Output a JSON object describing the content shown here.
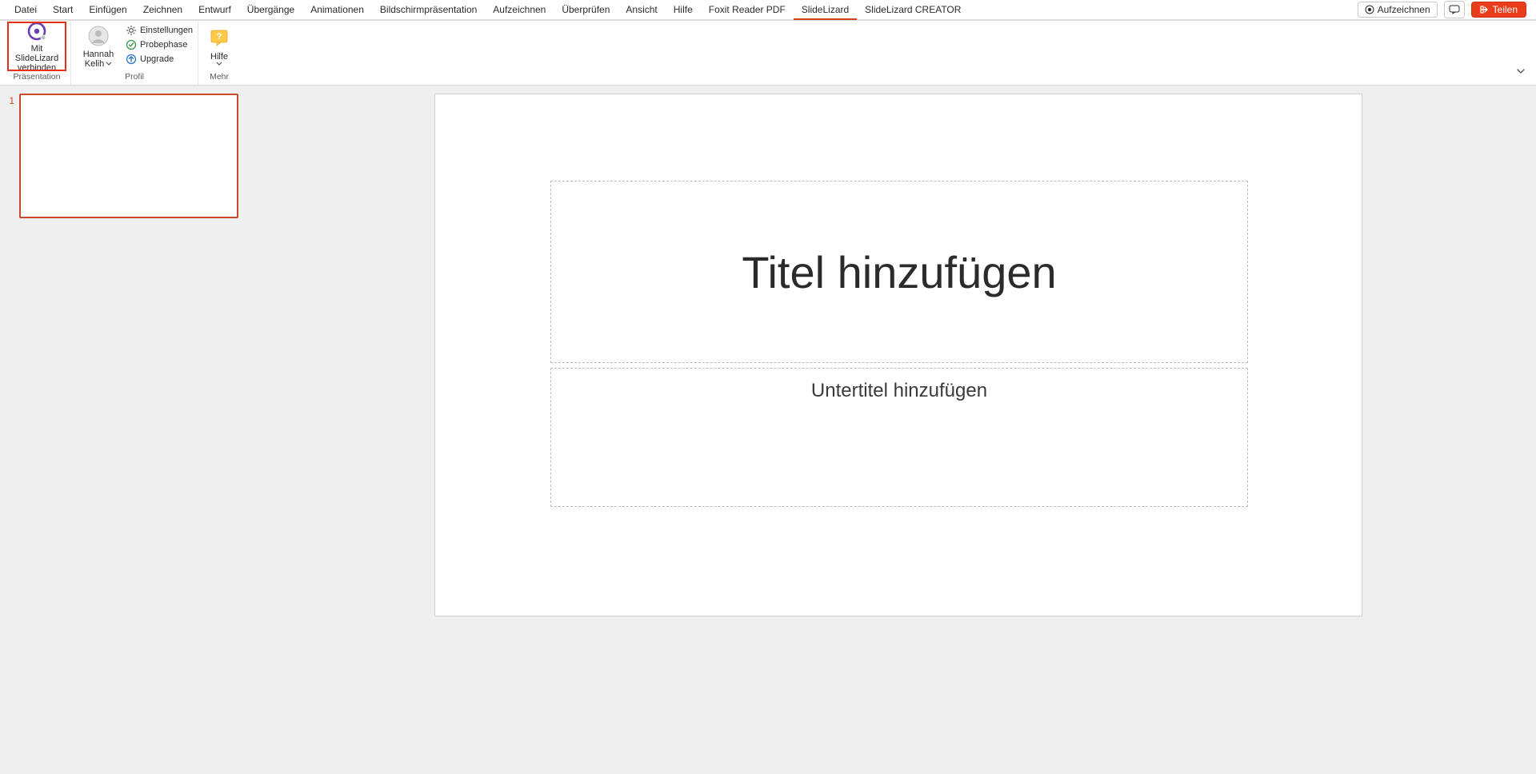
{
  "menu": {
    "tabs": [
      "Datei",
      "Start",
      "Einfügen",
      "Zeichnen",
      "Entwurf",
      "Übergänge",
      "Animationen",
      "Bildschirmpräsentation",
      "Aufzeichnen",
      "Überprüfen",
      "Ansicht",
      "Hilfe",
      "Foxit Reader PDF",
      "SlideLizard",
      "SlideLizard CREATOR"
    ],
    "active_index": 13
  },
  "title_actions": {
    "record": "Aufzeichnen",
    "share": "Teilen"
  },
  "ribbon": {
    "group_presentation": {
      "label": "Präsentation",
      "connect_line1": "Mit SlideLizard",
      "connect_line2": "verbinden"
    },
    "group_profile": {
      "label": "Profil",
      "user_line1": "Hannah",
      "user_line2": "Kelih",
      "settings": "Einstellungen",
      "rehearsal": "Probephase",
      "upgrade": "Upgrade"
    },
    "group_more": {
      "label": "Mehr",
      "help": "Hilfe"
    }
  },
  "thumbnails": {
    "items": [
      {
        "number": "1"
      }
    ]
  },
  "slide": {
    "title_placeholder": "Titel hinzufügen",
    "subtitle_placeholder": "Untertitel hinzufügen"
  }
}
